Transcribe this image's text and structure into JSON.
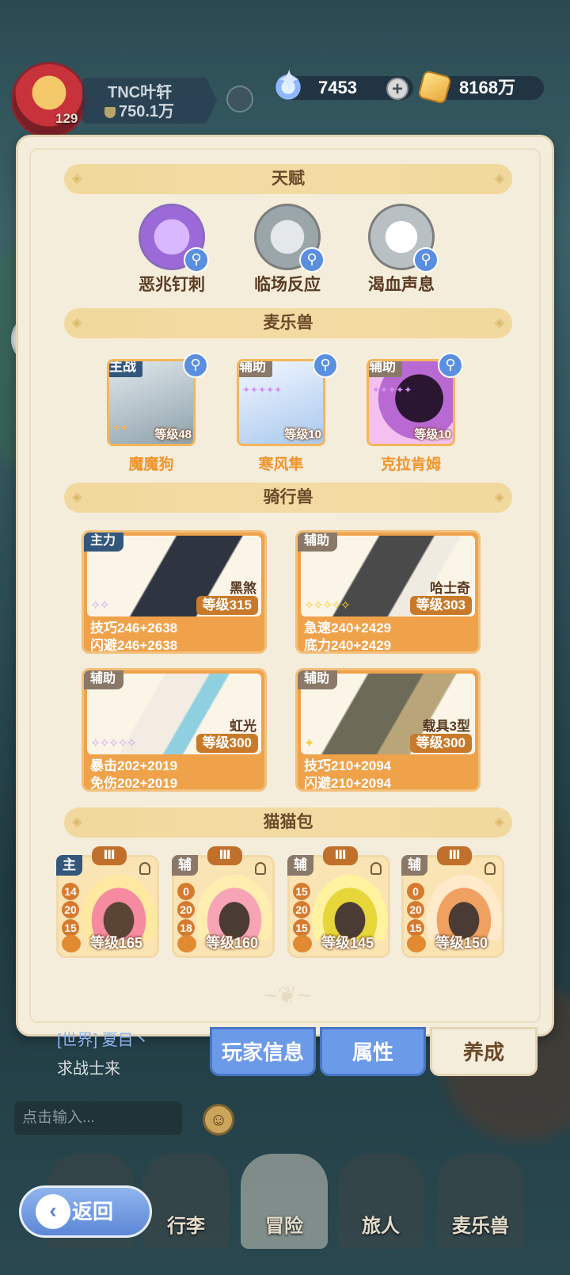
{
  "player": {
    "name": "TNC叶轩",
    "power": "750.1万",
    "level": "129"
  },
  "currency": {
    "gems": "7453",
    "gold": "8168万",
    "plus": "+"
  },
  "sections": {
    "talent": "天赋",
    "mailebeast": "麦乐兽",
    "riding": "骑行兽",
    "catpack": "猫猫包"
  },
  "talents": [
    {
      "name": "恶兆钉刺",
      "icon": "spike-talent-icon",
      "color": "#b48ae8"
    },
    {
      "name": "临场反应",
      "icon": "reaction-talent-icon",
      "color": "#9aa6aa"
    },
    {
      "name": "渴血声息",
      "icon": "bloodthirst-talent-icon",
      "color": "#b8c0c4"
    }
  ],
  "pets": [
    {
      "role": "主战",
      "level": "等级48",
      "name": "魔魔狗",
      "stars": "✦✦"
    },
    {
      "role": "辅助",
      "level": "等级10",
      "name": "寒风隼",
      "stars": "✦✦✦✦✦"
    },
    {
      "role": "辅助",
      "level": "等级10",
      "name": "克拉肯姆",
      "stars": "✦✦✦✦✦"
    }
  ],
  "rides": [
    {
      "role": "主力",
      "name": "黑煞",
      "level": "等级315",
      "stars": "✧✧",
      "stat1": "技巧246+2638",
      "stat2": "闪避246+2638"
    },
    {
      "role": "辅助",
      "name": "哈士奇",
      "level": "等级303",
      "stars": "✧✧✧✧✧",
      "stat1": "急速240+2429",
      "stat2": "底力240+2429"
    },
    {
      "role": "辅助",
      "name": "虹光",
      "level": "等级300",
      "stars": "✧✧✧✧✧",
      "stat1": "暴击202+2019",
      "stat2": "免伤202+2019"
    },
    {
      "role": "辅助",
      "name": "载具3型",
      "level": "等级300",
      "stars": "✦",
      "stat1": "技巧210+2094",
      "stat2": "闪避210+2094"
    }
  ],
  "cats": [
    {
      "role": "主",
      "tier": "Ⅲ",
      "nums": [
        "14",
        "20",
        "15"
      ],
      "level": "等级165"
    },
    {
      "role": "辅",
      "tier": "Ⅲ",
      "nums": [
        "0",
        "20",
        "18"
      ],
      "level": "等级160"
    },
    {
      "role": "辅",
      "tier": "Ⅲ",
      "nums": [
        "15",
        "20",
        "15"
      ],
      "level": "等级145"
    },
    {
      "role": "辅",
      "tier": "Ⅲ",
      "nums": [
        "0",
        "20",
        "15"
      ],
      "level": "等级150"
    }
  ],
  "tabs": {
    "info": "玩家信息",
    "attr": "属性",
    "grow": "养成"
  },
  "chat": {
    "line1": "[世界] 夏目丶",
    "line2": "求战士来",
    "placeholder": "点击输入..."
  },
  "nav": {
    "bag": "行李",
    "adventure": "冒险",
    "traveler": "旅人",
    "mailebeast": "麦乐兽"
  },
  "back": "返回"
}
